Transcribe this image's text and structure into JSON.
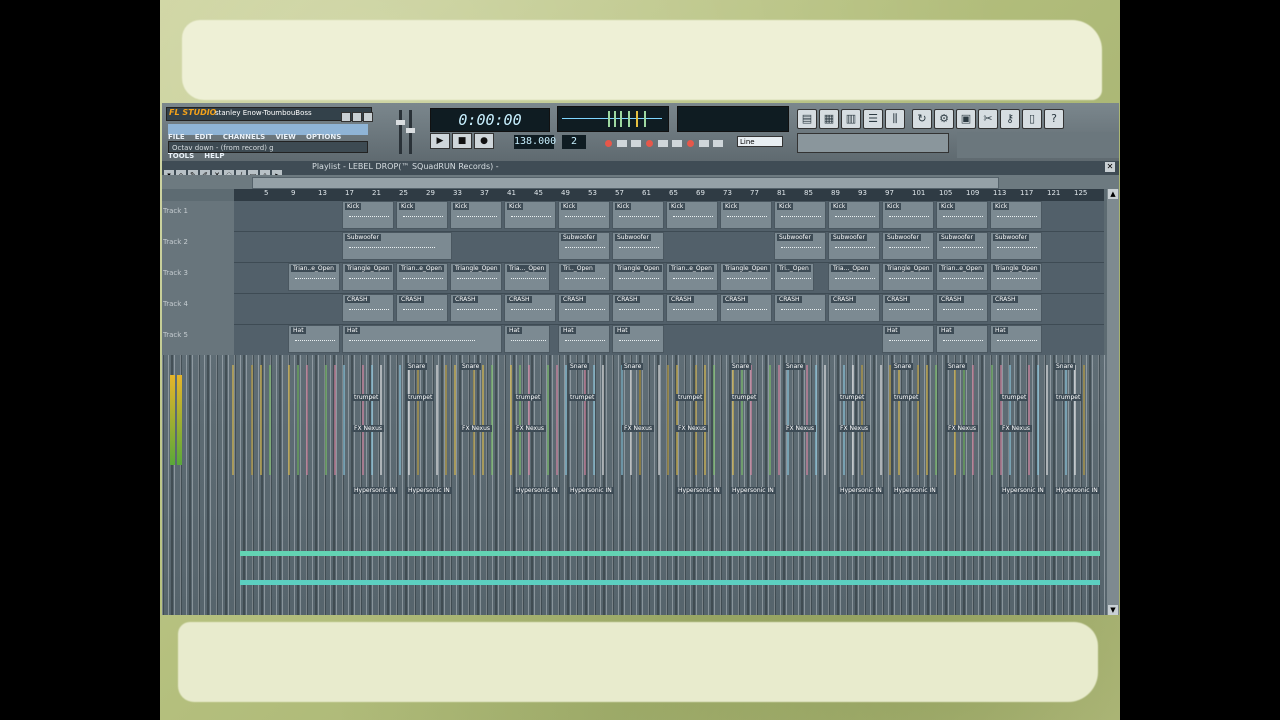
{
  "app": {
    "brand": "FL STUDIO",
    "project_title": "stanley Enow-ToumbouBoss",
    "menu": [
      "FILE",
      "EDIT",
      "CHANNELS",
      "VIEW",
      "OPTIONS",
      "TOOLS",
      "HELP"
    ],
    "hint": "Octav down - (from record) g",
    "time_display": "0:00:00",
    "tempo": "138.000",
    "pattern_number": "2",
    "line_mode": "Line",
    "accent_color": "#f4a21a"
  },
  "playlist": {
    "title": "Playlist - LEBEL DROP(™ SQuadRUN Records) -",
    "ruler_marks": [
      "5",
      "9",
      "13",
      "17",
      "21",
      "25",
      "29",
      "33",
      "37",
      "41",
      "45",
      "49",
      "53",
      "57",
      "61",
      "65",
      "69",
      "73",
      "77",
      "81",
      "85",
      "89",
      "93",
      "97",
      "101",
      "105",
      "109",
      "113",
      "117",
      "121",
      "125"
    ],
    "tracks": [
      {
        "name": "Track 1"
      },
      {
        "name": "Track 2"
      },
      {
        "name": "Track 3"
      },
      {
        "name": "Track 4"
      },
      {
        "name": "Track 5"
      }
    ],
    "clip_labels": {
      "kick": "Kick",
      "sub": "Subwoofer",
      "tri_a": "Trian..e_Open",
      "tri_b": "Triangle_Open",
      "tri_c": "Tri.._Open",
      "tri_d": "Tria..._Open",
      "crash": "CRASH",
      "hat": "Hat",
      "snare": "Snare",
      "trumpet": "trumpet",
      "nexus": "FX Nexus",
      "hyper": "Hypersonic IN"
    }
  }
}
